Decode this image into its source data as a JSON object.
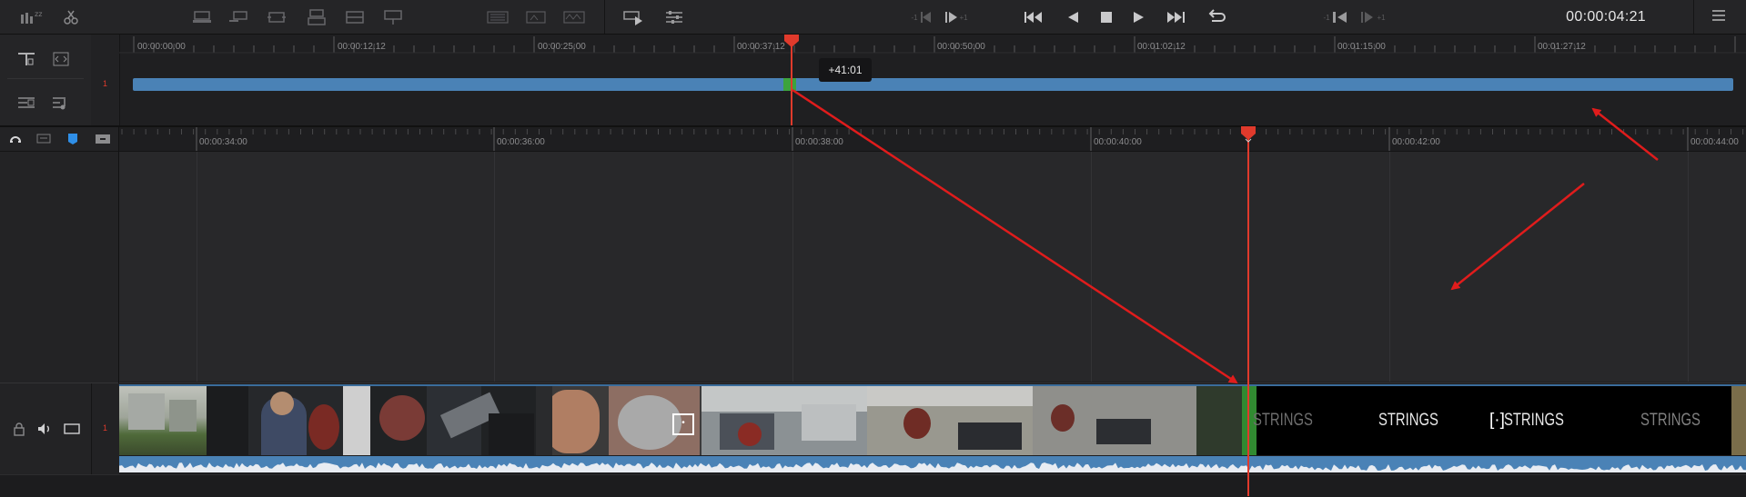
{
  "toolbar": {
    "timecode": "00:00:04:21",
    "left_icons": [
      "zoom-icon",
      "scissors-icon"
    ],
    "edit_icons": [
      "insert-clip-icon",
      "overwrite-clip-icon",
      "replace-clip-icon",
      "place-on-top-icon",
      "append-end-icon",
      "ripple-overwrite-icon"
    ],
    "transition_icons": [
      "smooth-cut-icon",
      "cross-dissolve-icon",
      "video-only-icon"
    ],
    "trim_icons": [
      "trim-icon",
      "settings-sliders-icon"
    ],
    "prev_clip_suffix": "-1",
    "next_clip_suffix": "+1",
    "prev_frame_suffix": "-1",
    "next_frame_suffix": "+1"
  },
  "upper_timeline": {
    "track_number": "1",
    "ticks": [
      "00:00:00:00",
      "00:00:12:12",
      "00:00:25:00",
      "00:00:37:12",
      "00:00:50:00",
      "00:01:02:12",
      "00:01:15:00",
      "00:01:27:12"
    ],
    "tooltip": "+41:01"
  },
  "main_timeline": {
    "ticks": [
      "00:00:34:00",
      "00:00:36:00",
      "00:00:38:00",
      "00:00:40:00",
      "00:00:42:00",
      "00:00:44:00"
    ],
    "track_number": "1",
    "strings_labels": [
      "STRINGS",
      "STRINGS",
      "STRINGS",
      "STRINGS"
    ]
  },
  "colors": {
    "playhead": "#e03a2c",
    "clip_blue": "#4a82b6",
    "annotation_arrows": "#e01c1c",
    "green_marker": "#3da33d"
  }
}
